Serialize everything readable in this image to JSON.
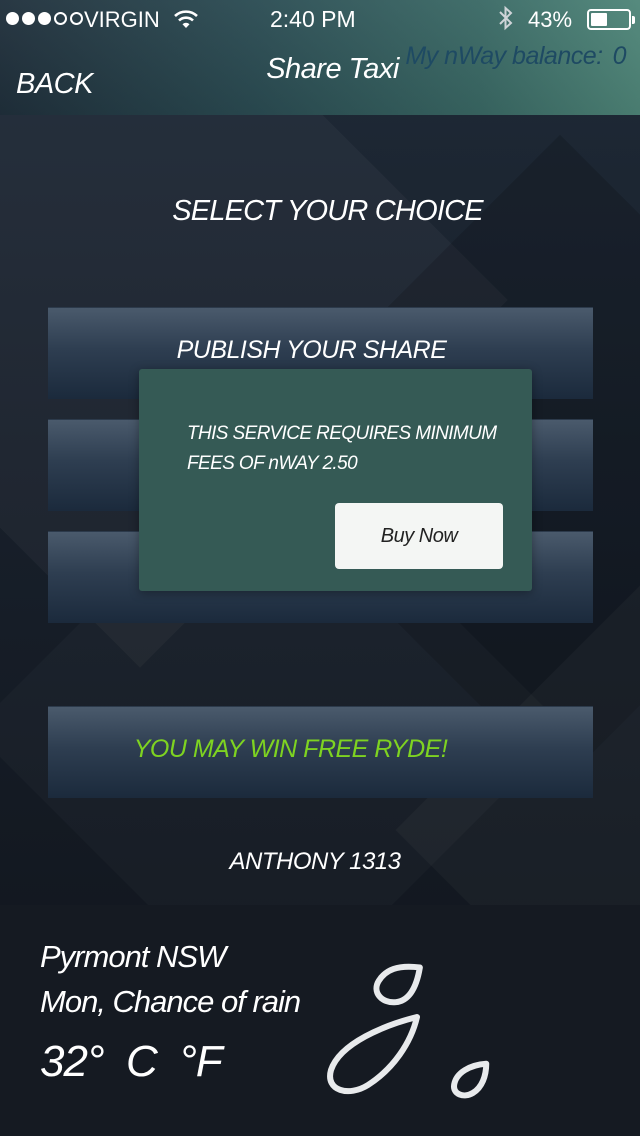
{
  "status_bar": {
    "carrier": "VIRGIN",
    "time": "2:40 PM",
    "battery_percent": "43%",
    "battery_level": 0.43,
    "signal_bars": 3,
    "signal_total": 5,
    "icons": [
      "wifi-icon",
      "bluetooth-icon",
      "battery-icon"
    ]
  },
  "header": {
    "back_label": "BACK",
    "title": "Share Taxi",
    "balance_label": "My nWay balance:",
    "balance_value": "0"
  },
  "main": {
    "heading": "SELECT YOUR CHOICE",
    "options": [
      {
        "label": "PUBLISH YOUR SHARE"
      },
      {
        "label": ""
      },
      {
        "label": ""
      }
    ],
    "promo_label": "YOU MAY WIN FREE RYDE!",
    "promo_color": "#7ed321",
    "username": "ANTHONY 1313"
  },
  "modal": {
    "message_line1": "THIS SERVICE REQUIRES MINIMUM",
    "message_line2": "FEES OF nWAY 2.50",
    "buy_label": "Buy Now"
  },
  "weather": {
    "location": "Pyrmont  NSW",
    "condition": "Mon, Chance of rain",
    "temperature": "32°  C  °F",
    "icon": "rain-drops-icon"
  },
  "colors": {
    "header_start": "#20303c",
    "header_end": "#4f8679",
    "modal_bg": "#355a55",
    "balance_text": "#1e4a63"
  }
}
